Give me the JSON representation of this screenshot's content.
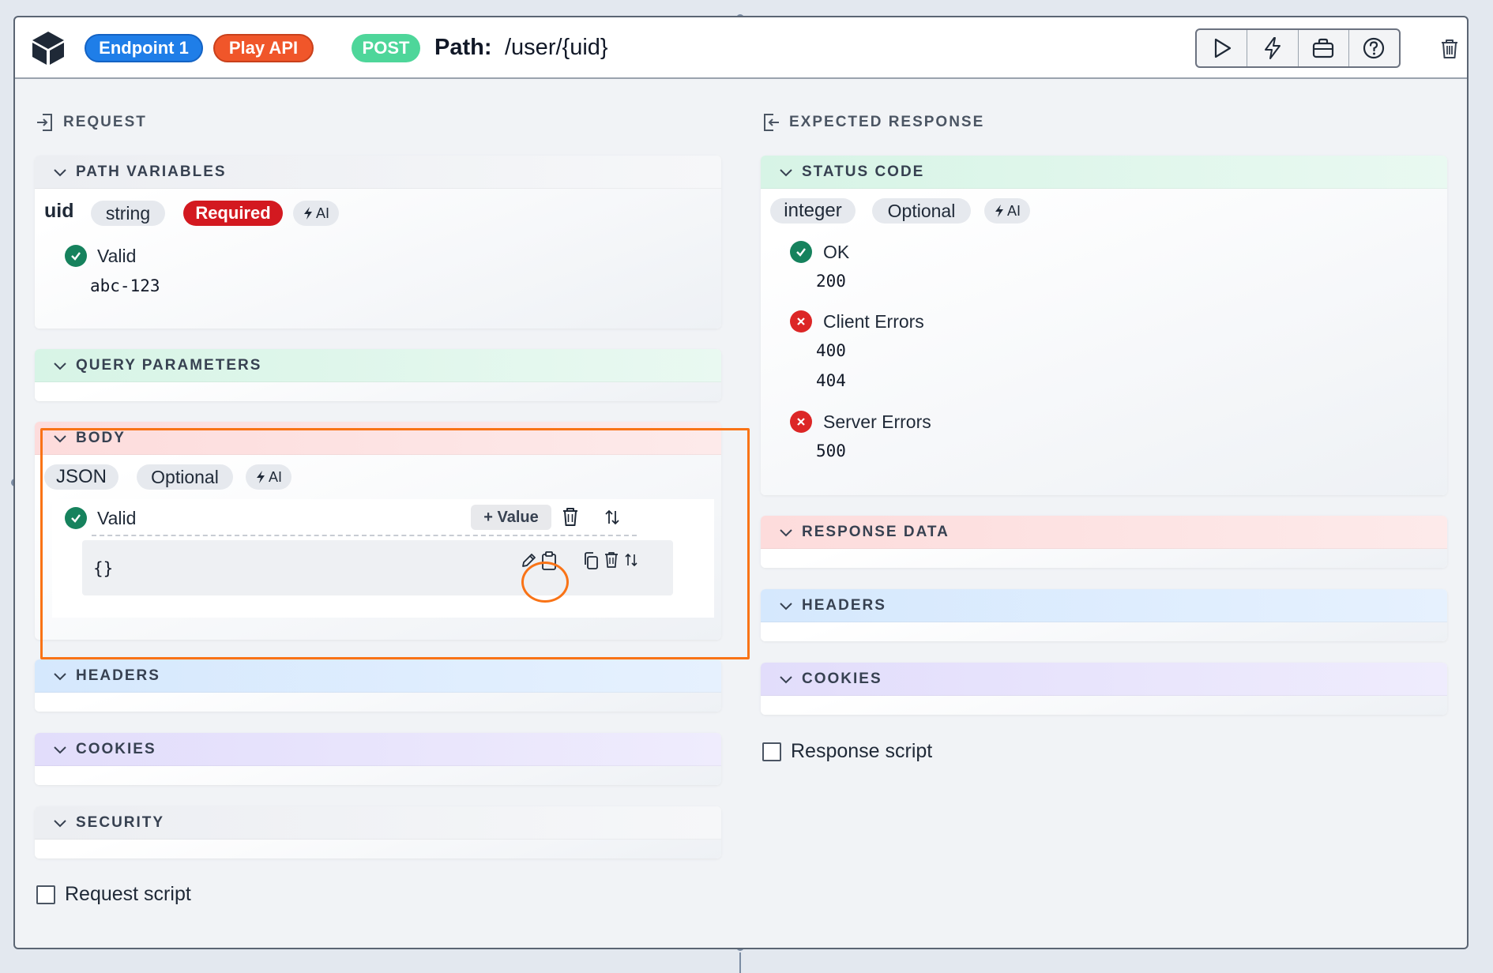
{
  "header": {
    "endpoint_label": "Endpoint 1",
    "play_label": "Play API",
    "method": "POST",
    "path_label": "Path:",
    "path_value": "/user/{uid}"
  },
  "toolbar_icons": [
    "play-icon",
    "lightning-icon",
    "briefcase-icon",
    "help-icon"
  ],
  "request": {
    "title": "REQUEST",
    "path_variables": {
      "title": "PATH VARIABLES",
      "name": "uid",
      "type": "string",
      "required": "Required",
      "ai": "AI",
      "status": "Valid",
      "value": "abc-123"
    },
    "query_parameters": {
      "title": "QUERY PARAMETERS"
    },
    "body": {
      "title": "BODY",
      "type": "JSON",
      "optional": "Optional",
      "ai": "AI",
      "status": "Valid",
      "add_value": "+ Value",
      "value": "{}"
    },
    "headers": {
      "title": "HEADERS"
    },
    "cookies": {
      "title": "COOKIES"
    },
    "security": {
      "title": "SECURITY"
    },
    "script_label": "Request script"
  },
  "response": {
    "title": "EXPECTED RESPONSE",
    "status_code": {
      "title": "STATUS CODE",
      "type": "integer",
      "optional": "Optional",
      "ai": "AI",
      "groups": [
        {
          "label": "OK",
          "codes": [
            "200"
          ]
        },
        {
          "label": "Client Errors",
          "codes": [
            "400",
            "404"
          ]
        },
        {
          "label": "Server Errors",
          "codes": [
            "500"
          ]
        }
      ]
    },
    "response_data": {
      "title": "RESPONSE DATA"
    },
    "headers": {
      "title": "HEADERS"
    },
    "cookies": {
      "title": "COOKIES"
    },
    "script_label": "Response script"
  },
  "colors": {
    "endpoint": "#1f7ee8",
    "play": "#f0562a",
    "post": "#4ed69a",
    "required": "#d31920",
    "valid": "#16825d",
    "error": "#dc2626",
    "highlight": "#f97316"
  }
}
